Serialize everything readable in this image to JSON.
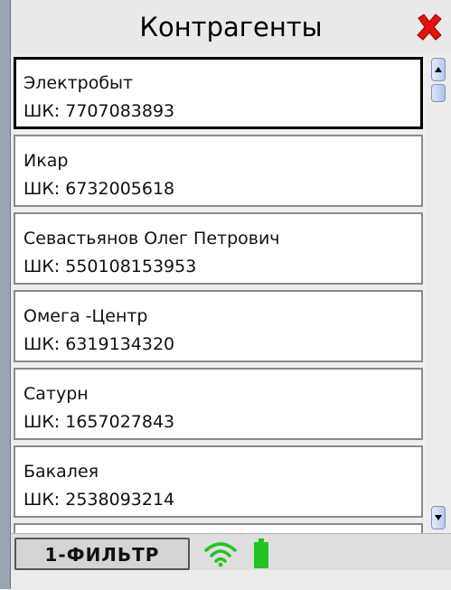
{
  "header": {
    "title": "Контрагенты",
    "close_icon": "close-x-icon",
    "close_color": "#e8120c"
  },
  "list": {
    "items": [
      {
        "name": "Электробыт",
        "code": "ШК: 7707083893",
        "selected": true
      },
      {
        "name": "Икар",
        "code": "ШК: 6732005618"
      },
      {
        "name": "Севастьянов Олег Петрович",
        "code": "ШК: 550108153953"
      },
      {
        "name": "Омега -Центр",
        "code": "ШК: 6319134320"
      },
      {
        "name": "Сатурн",
        "code": "ШК: 1657027843"
      },
      {
        "name": "Бакалея",
        "code": "ШК: 2538093214"
      }
    ]
  },
  "footer": {
    "filter_label": "1-ФИЛЬТР",
    "wifi_icon": "wifi-icon",
    "battery_icon": "battery-icon",
    "status_color": "#22c322"
  }
}
